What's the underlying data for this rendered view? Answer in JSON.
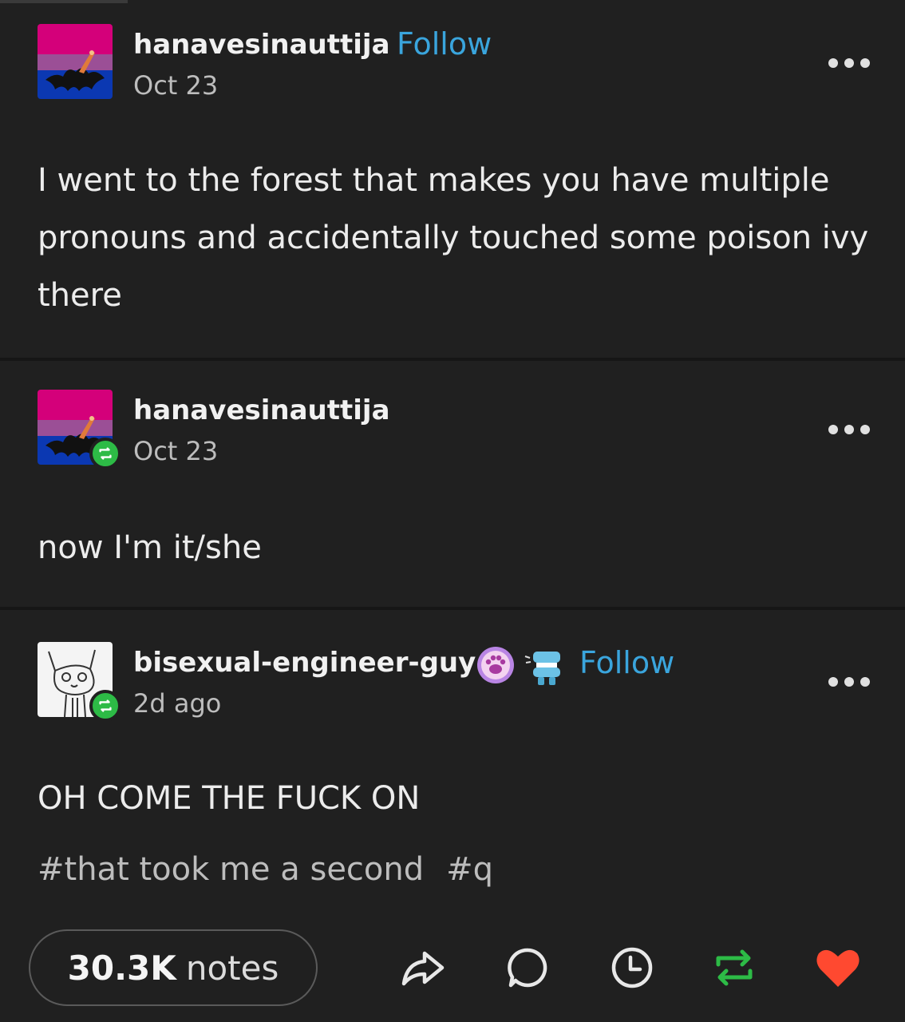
{
  "posts": [
    {
      "username": "hanavesinauttija",
      "follow_label": "Follow",
      "date": "Oct 23",
      "body": "I went to the forest that makes you have multiple pronouns and accidentally touched some poison ivy there",
      "avatar_icon": "bi-flag-bat-avatar",
      "reblog_badge": false
    },
    {
      "username": "hanavesinauttija",
      "date": "Oct 23",
      "body": "now I'm it/she",
      "avatar_icon": "bi-flag-bat-avatar",
      "reblog_badge": true
    },
    {
      "username": "bisexual-engineer-guy",
      "follow_label": "Follow",
      "date": "2d ago",
      "body": "OH COME THE FUCK ON",
      "tags": [
        "#that took me a second",
        "#q"
      ],
      "avatar_icon": "cat-sketch-avatar",
      "badges": [
        "paw-badge-icon",
        "chattering-teeth-badge-icon"
      ],
      "reblog_badge": true
    }
  ],
  "footer": {
    "notes_count": "30.3K",
    "notes_label": "notes",
    "actions": [
      "share-icon",
      "reply-icon",
      "queue-clock-icon",
      "reblog-icon",
      "like-heart-icon"
    ]
  },
  "colors": {
    "background": "#202020",
    "follow": "#3aa5dd",
    "reblog_green": "#2dbb46",
    "like_red": "#ff4930",
    "flag_pink": "#d4007a",
    "flag_purple": "#9b4f96",
    "flag_blue": "#0b38b2"
  }
}
